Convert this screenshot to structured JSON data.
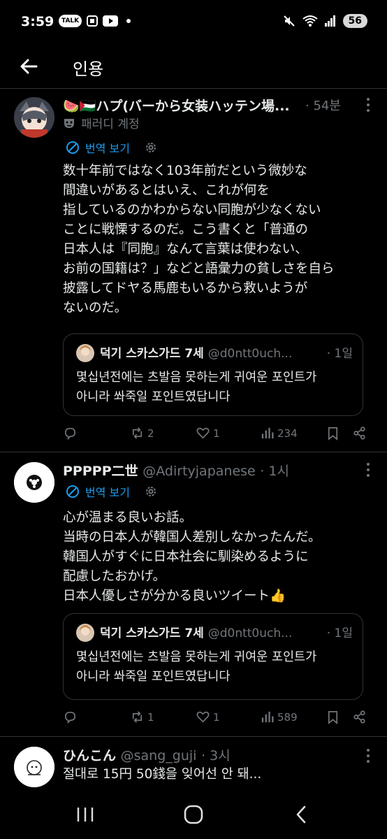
{
  "status_bar": {
    "time": "3:59",
    "battery": "56",
    "chip_talk": "TALK"
  },
  "header": {
    "title": "인용"
  },
  "posts": [
    {
      "name": "🍉🇵🇸ハプ(バーから女装ハッテン場...",
      "time": "· 54분",
      "badge": "패러디 계정",
      "translate": "번역 보기",
      "body": "数十年前ではなく103年前だという微妙な\n間違いがあるとはいえ、これが何を\n指しているのかわからない同胞が少なくない\nことに戦慄するのだ。こう書くと「普通の\n日本人は『同胞』なんて言葉は使わない、\nお前の国籍は？」などと語彙力の貧しさを自ら\n披露してドヤる馬鹿もいるから救いようが\nないのだ。",
      "quote": {
        "name": "덕기 스카스가드 7세",
        "handle": "@d0ntt0uch...",
        "time": "· 1일",
        "text": "몇십년전에는 츠발음 못하는게 귀여운 포인트가\n아니라 쏴죽일 포인트였답니다"
      },
      "actions": {
        "retweets": "2",
        "likes": "1",
        "views": "234"
      }
    },
    {
      "name": "PPPPP二世",
      "handle": "@Adirtyjapanese",
      "time": "· 1시",
      "translate": "번역 보기",
      "body": "心が温まる良いお話。\n当時の日本人が韓国人差別しなかったんだ。\n韓国人がすぐに日本社会に馴染めるように\n配慮したおかげ。\n日本人優しさが分かる良いツイート👍",
      "quote": {
        "name": "덕기 스카스가드 7세",
        "handle": "@d0ntt0uch...",
        "time": "· 1일",
        "text": "몇십년전에는 츠발음 못하는게 귀여운 포인트가\n아니라 쏴죽일 포인트였답니다"
      },
      "actions": {
        "retweets": "1",
        "likes": "1",
        "views": "589"
      }
    },
    {
      "name": "ひんこん",
      "handle": "@sang_guji",
      "time": "· 3시",
      "body": "절대로 15円 50錢을 잊어선 안 돼..."
    }
  ]
}
